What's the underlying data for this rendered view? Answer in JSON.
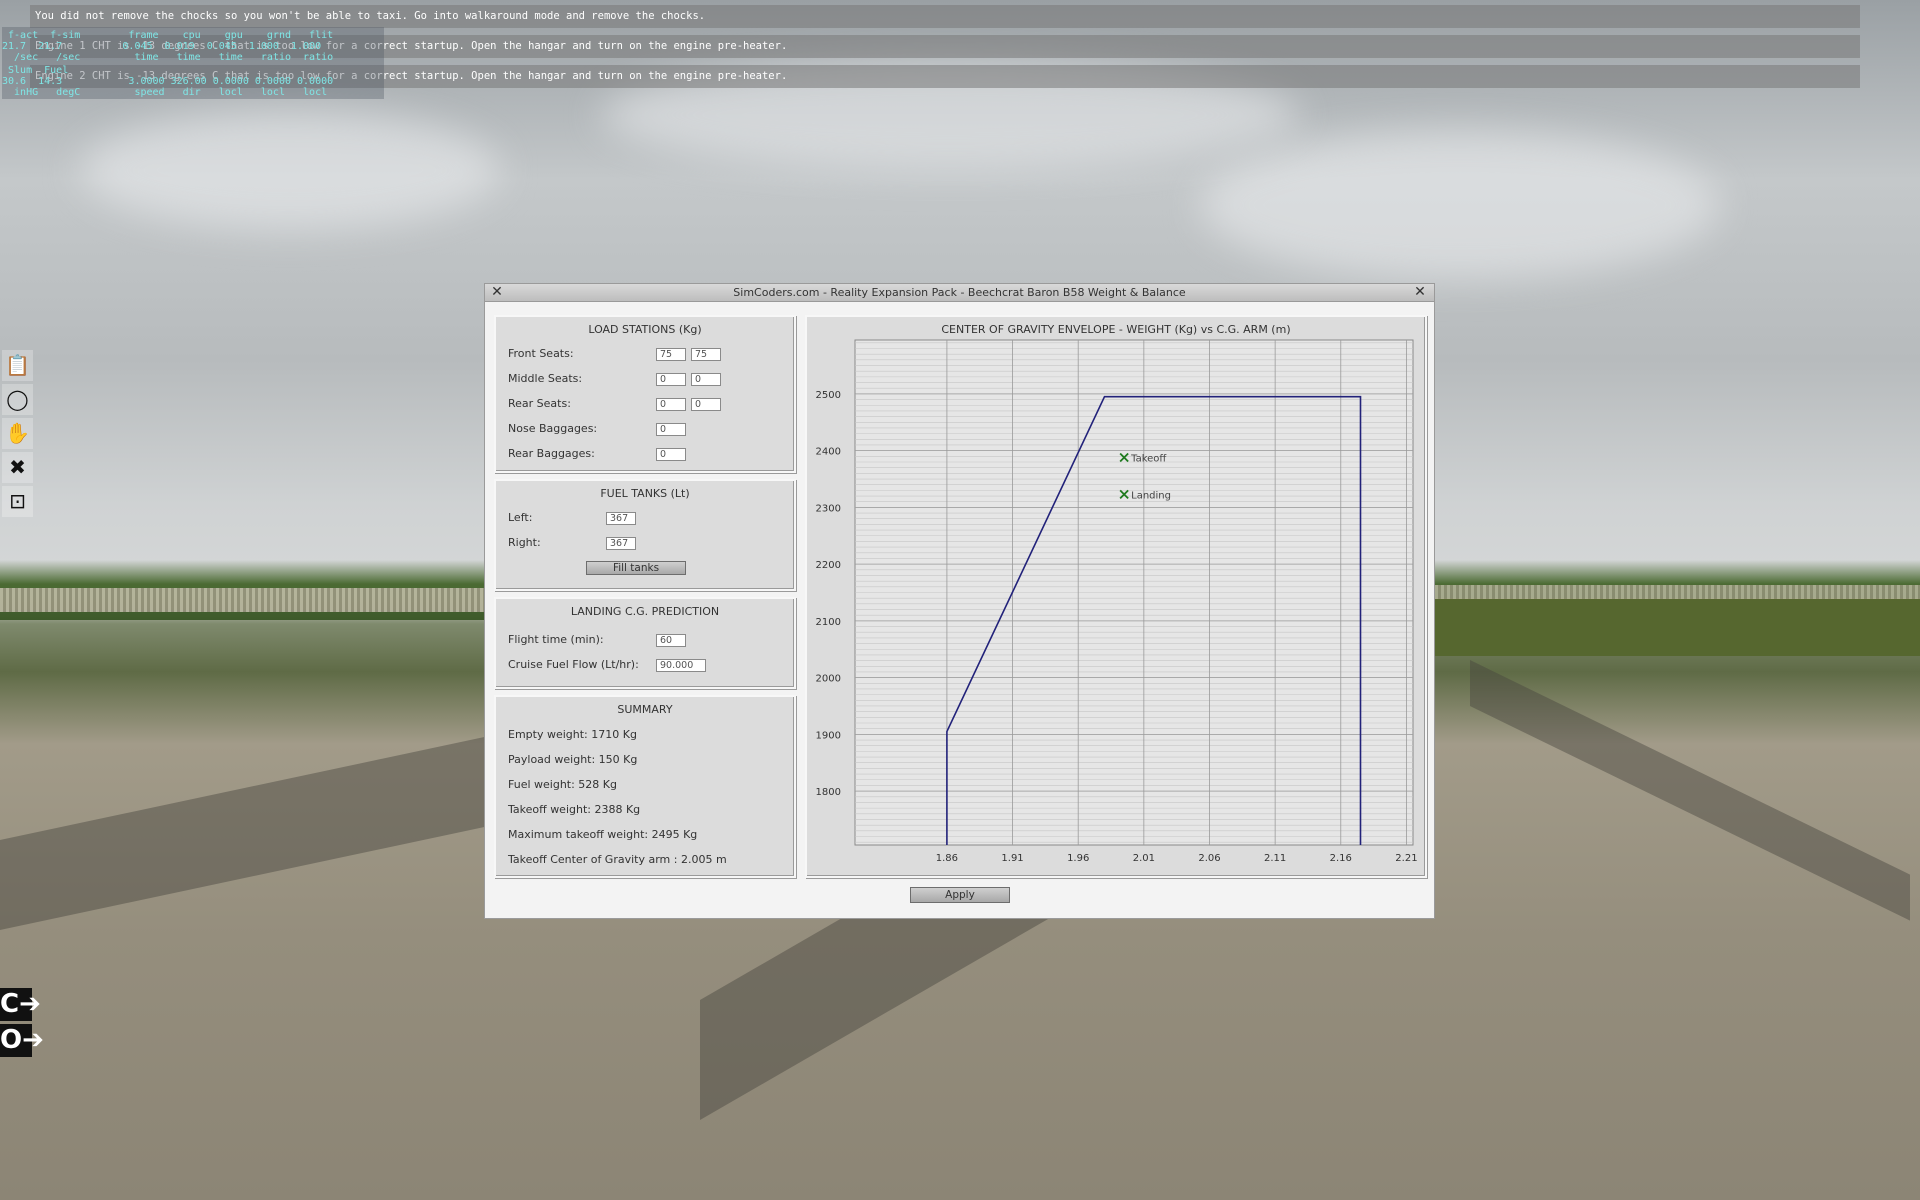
{
  "messages": [
    "You did not remove the chocks so you won't be able to taxi. Go into walkaround mode and remove the chocks.",
    "Engine 1 CHT is -13 degrees C that is too low for a correct startup. Open the hangar and turn on the engine pre-heater.",
    "Engine 2 CHT is -13 degrees C that is too low for a correct startup. Open the hangar and turn on the engine pre-heater."
  ],
  "stats": {
    "row1": " f-act  f-sim        frame    cpu    gpu    grnd   flit",
    "row2": "21.7  21.7          0.045  0.019  0.045  1.000  1.000",
    "row3": "  /sec   /sec         time   time   time   ratio  ratio",
    "row4": " Slum  Fuel",
    "row5": "30.6  14.3           3.0000 326.00 0.0000 0.0000 0.0000",
    "row6": "  inHG   degC         speed   dir   locl   locl   locl"
  },
  "toolbar": [
    {
      "name": "checklist-icon",
      "glyph": "📋"
    },
    {
      "name": "rotate-icon",
      "glyph": "◯"
    },
    {
      "name": "hand-icon",
      "glyph": "✋"
    },
    {
      "name": "tools-icon",
      "glyph": "✖"
    },
    {
      "name": "chart-icon",
      "glyph": "⊡"
    }
  ],
  "commands": [
    "C➔",
    "O➔"
  ],
  "dialog": {
    "title": "SimCoders.com - Reality Expansion Pack - Beechcrat Baron B58 Weight & Balance",
    "close_glyph": "✕",
    "load_stations": {
      "title": "LOAD STATIONS (Kg)",
      "front_seats_label": "Front Seats:",
      "front_left": "75",
      "front_right": "75",
      "middle_seats_label": "Middle Seats:",
      "middle_left": "0",
      "middle_right": "0",
      "rear_seats_label": "Rear Seats:",
      "rear_left": "0",
      "rear_right": "0",
      "nose_baggages_label": "Nose Baggages:",
      "nose_baggages": "0",
      "rear_baggages_label": "Rear Baggages:",
      "rear_baggages": "0"
    },
    "fuel_tanks": {
      "title": "FUEL TANKS (Lt)",
      "left_label": "Left:",
      "left": "367",
      "right_label": "Right:",
      "right": "367",
      "fill_button": "Fill tanks"
    },
    "landing_prediction": {
      "title": "LANDING C.G. PREDICTION",
      "flight_time_label": "Flight time (min):",
      "flight_time": "60",
      "fuel_flow_label": "Cruise Fuel Flow (Lt/hr):",
      "fuel_flow": "90.000"
    },
    "summary": {
      "title": "SUMMARY",
      "empty_weight": "Empty weight: 1710 Kg",
      "payload_weight": "Payload weight: 150 Kg",
      "fuel_weight": "Fuel weight: 528 Kg",
      "takeoff_weight": "Takeoff weight: 2388 Kg",
      "max_takeoff_weight": "Maximum takeoff weight: 2495 Kg",
      "takeoff_cg_arm": "Takeoff Center of Gravity arm : 2.005 m"
    },
    "apply_button": "Apply"
  },
  "chart_data": {
    "type": "line",
    "title": "CENTER OF GRAVITY ENVELOPE - WEIGHT (Kg) vs C.G. ARM (m)",
    "xlim": [
      1.79,
      2.215
    ],
    "ylim": [
      1705,
      2595
    ],
    "x_ticks": [
      1.86,
      1.91,
      1.96,
      2.01,
      2.06,
      2.11,
      2.16,
      2.21
    ],
    "y_ticks": [
      1800,
      1900,
      2000,
      2100,
      2200,
      2300,
      2400,
      2500
    ],
    "envelope": [
      [
        1.86,
        1705
      ],
      [
        1.86,
        1905
      ],
      [
        1.98,
        2495
      ],
      [
        2.175,
        2495
      ],
      [
        2.175,
        1705
      ]
    ],
    "points": [
      {
        "label": "Takeoff",
        "x": 1.995,
        "y": 2388
      },
      {
        "label": "Landing",
        "x": 1.995,
        "y": 2323
      }
    ],
    "color": "#22227a",
    "marker_color": "#1e7a1e"
  }
}
